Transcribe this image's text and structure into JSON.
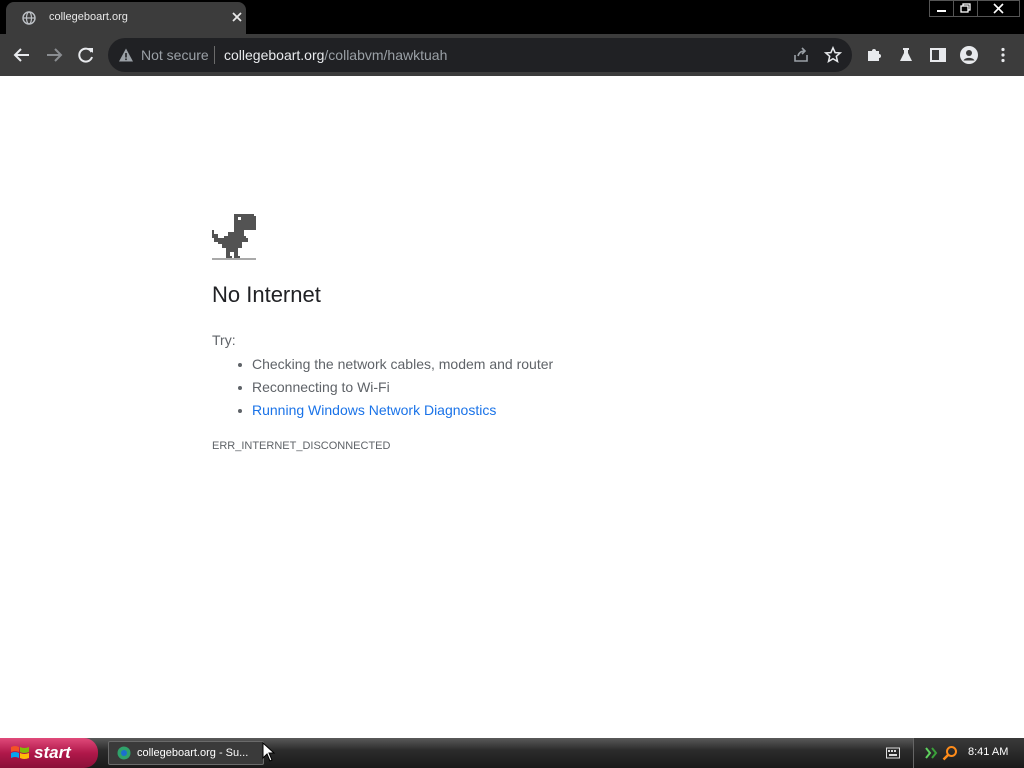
{
  "browser": {
    "tab": {
      "title": "collegeboart.org",
      "favicon": "globe-icon"
    },
    "omnibox": {
      "security_label": "Not secure",
      "url_host": "collegeboart.org",
      "url_path": "/collabvm/hawktuah"
    }
  },
  "page": {
    "heading": "No Internet",
    "try_label": "Try:",
    "suggestions": [
      "Checking the network cables, modem and router",
      "Reconnecting to Wi-Fi",
      "Running Windows Network Diagnostics"
    ],
    "error_code": "ERR_INTERNET_DISCONNECTED"
  },
  "taskbar": {
    "start_label": "start",
    "task_item_label": "collegeboart.org - Su...",
    "clock": "8:41 AM"
  },
  "colors": {
    "link": "#1a73e8",
    "chrome_dark": "#3c3c3c",
    "start_button": "#b0184a"
  }
}
